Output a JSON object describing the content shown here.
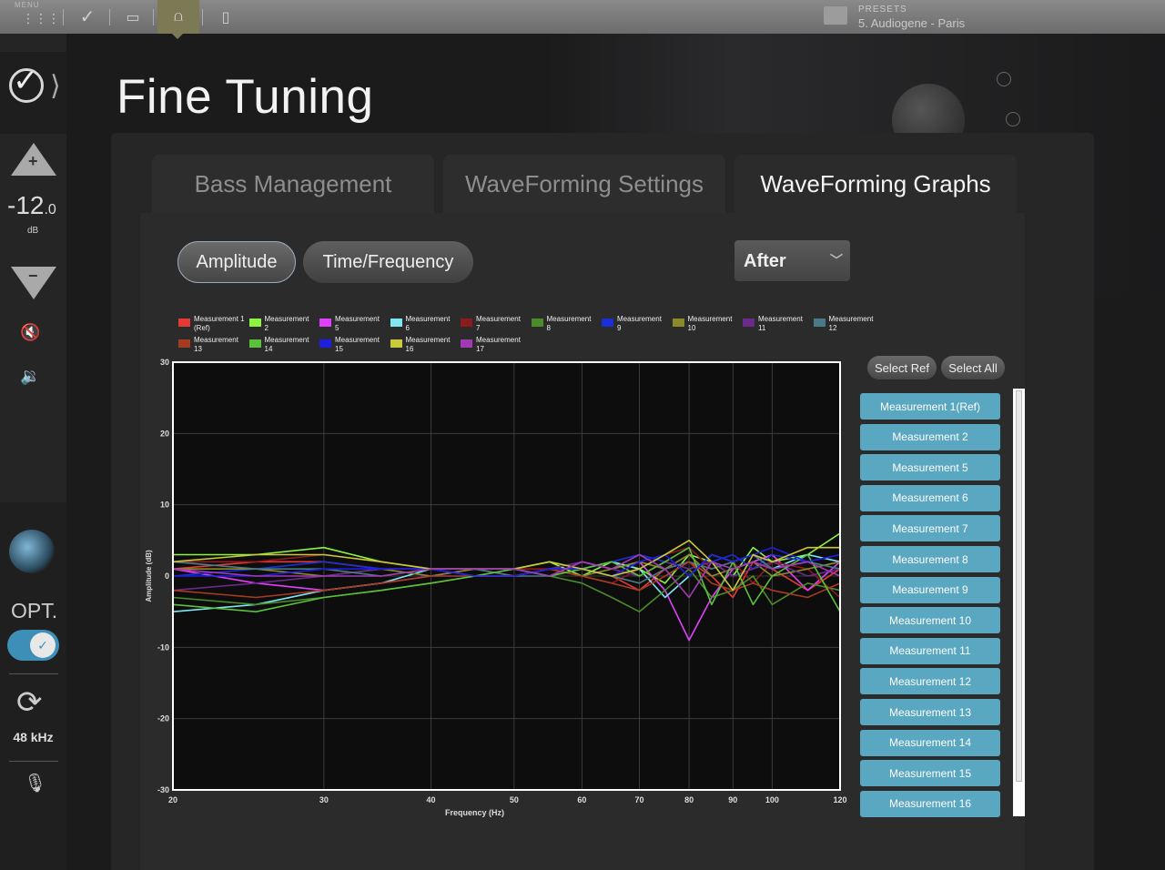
{
  "topbar": {
    "menu_label": "MENU",
    "presets_label": "PRESETS",
    "preset_value": "5. Audiogene - Paris"
  },
  "sidebar": {
    "volume_value": "-12",
    "volume_decimal": ".0",
    "volume_unit": "dB",
    "input_label": "OPT.",
    "sample_rate": "48 kHz"
  },
  "page": {
    "title": "Fine Tuning"
  },
  "tabs": [
    {
      "label": "Bass Management",
      "active": false
    },
    {
      "label": "WaveForming Settings",
      "active": false
    },
    {
      "label": "WaveForming Graphs",
      "active": true
    }
  ],
  "view_toggle": {
    "amplitude": "Amplitude",
    "time_frequency": "Time/Frequency"
  },
  "dropdown": {
    "value": "After"
  },
  "buttons": {
    "select_ref": "Select Ref",
    "select_all": "Select All"
  },
  "measurements": [
    "Measurement 1(Ref)",
    "Measurement 2",
    "Measurement 5",
    "Measurement 6",
    "Measurement 7",
    "Measurement 8",
    "Measurement 9",
    "Measurement 10",
    "Measurement 11",
    "Measurement 12",
    "Measurement 13",
    "Measurement 14",
    "Measurement 15",
    "Measurement 16"
  ],
  "chart_data": {
    "type": "line",
    "xlabel": "Frequency (Hz)",
    "ylabel": "Amplitude (dB)",
    "xscale": "log",
    "xlim": [
      20,
      120
    ],
    "ylim": [
      -30,
      30
    ],
    "xticks": [
      20,
      30,
      40,
      50,
      60,
      70,
      80,
      90,
      100,
      120
    ],
    "yticks": [
      30,
      20,
      10,
      0,
      -10,
      -20,
      -30
    ],
    "grid": true,
    "legend_placement": "top",
    "x": [
      20,
      25,
      30,
      35,
      40,
      45,
      50,
      55,
      60,
      65,
      70,
      75,
      80,
      85,
      90,
      95,
      100,
      110,
      120
    ],
    "series": [
      {
        "name": "Measurement 1 (Ref)",
        "color": "#e53935",
        "legend": [
          "Measurement 1",
          "(Ref)"
        ],
        "values": [
          1,
          2,
          2,
          1,
          1,
          1,
          0,
          1,
          1,
          0,
          -2,
          1,
          2,
          0,
          -3,
          2,
          1,
          -2,
          1
        ]
      },
      {
        "name": "Measurement 2",
        "color": "#8cf542",
        "legend": [
          "Measurement",
          "2"
        ],
        "values": [
          3,
          3,
          4,
          2,
          1,
          1,
          1,
          2,
          0,
          2,
          1,
          -1,
          3,
          2,
          0,
          4,
          2,
          3,
          6
        ]
      },
      {
        "name": "Measurement 5",
        "color": "#e040fb",
        "legend": [
          "Measurement",
          "5"
        ],
        "values": [
          1,
          -1,
          -2,
          -1,
          0,
          1,
          1,
          0,
          2,
          1,
          2,
          -2,
          -9,
          -3,
          1,
          2,
          3,
          -2,
          2
        ]
      },
      {
        "name": "Measurement 6",
        "color": "#7fe6f2",
        "legend": [
          "Measurement",
          "6"
        ],
        "values": [
          -5,
          -4,
          -2,
          -1,
          1,
          0,
          0,
          1,
          1,
          2,
          1,
          -3,
          0,
          3,
          2,
          3,
          1,
          3,
          2
        ]
      },
      {
        "name": "Measurement 7",
        "color": "#8b1a1a",
        "legend": [
          "Measurement",
          "7"
        ],
        "values": [
          2,
          2,
          3,
          2,
          1,
          0,
          1,
          1,
          0,
          -1,
          1,
          3,
          4,
          1,
          2,
          -1,
          2,
          1,
          -3
        ]
      },
      {
        "name": "Measurement 8",
        "color": "#4a8c2a",
        "legend": [
          "Measurement",
          "8"
        ],
        "values": [
          -3,
          -4,
          -3,
          -2,
          -1,
          0,
          1,
          0,
          -1,
          -3,
          -5,
          -2,
          1,
          -3,
          -2,
          0,
          -4,
          -1,
          -2
        ]
      },
      {
        "name": "Measurement 9",
        "color": "#1a2fd8",
        "legend": [
          "Measurement",
          "9"
        ],
        "values": [
          0,
          1,
          2,
          1,
          0,
          0,
          1,
          0,
          1,
          2,
          3,
          2,
          1,
          2,
          3,
          1,
          3,
          2,
          3
        ]
      },
      {
        "name": "Measurement 10",
        "color": "#8a8a2a",
        "legend": [
          "Measurement",
          "10"
        ],
        "values": [
          1,
          1,
          0,
          1,
          0,
          1,
          0,
          1,
          0,
          1,
          2,
          1,
          3,
          0,
          1,
          2,
          0,
          1,
          2
        ]
      },
      {
        "name": "Measurement 11",
        "color": "#6a2a8a",
        "legend": [
          "Measurement",
          "11"
        ],
        "values": [
          -2,
          -1,
          0,
          1,
          1,
          0,
          0,
          1,
          2,
          1,
          0,
          2,
          1,
          2,
          0,
          1,
          2,
          0,
          1
        ]
      },
      {
        "name": "Measurement 12",
        "color": "#4a7a88",
        "legend": [
          "Measurement",
          "12"
        ],
        "values": [
          2,
          1,
          1,
          0,
          1,
          1,
          0,
          0,
          1,
          0,
          -1,
          1,
          2,
          1,
          2,
          3,
          1,
          2,
          1
        ]
      },
      {
        "name": "Measurement 13",
        "color": "#a83a22",
        "legend": [
          "Measurement 13"
        ],
        "values": [
          -2,
          -3,
          -2,
          -1,
          0,
          0,
          0,
          1,
          0,
          -1,
          -2,
          0,
          2,
          -1,
          -2,
          -1,
          -2,
          -3,
          -1
        ]
      },
      {
        "name": "Measurement 14",
        "color": "#5ac23a",
        "legend": [
          "Measurement",
          "14"
        ],
        "values": [
          -4,
          -5,
          -3,
          -2,
          -1,
          0,
          1,
          0,
          1,
          2,
          0,
          2,
          4,
          -4,
          2,
          -4,
          0,
          3,
          -5
        ]
      },
      {
        "name": "Measurement 15",
        "color": "#1e1ee0",
        "legend": [
          "Measurement",
          "15"
        ],
        "values": [
          0,
          0,
          1,
          1,
          1,
          0,
          0,
          1,
          1,
          0,
          2,
          3,
          0,
          3,
          2,
          3,
          4,
          2,
          3
        ]
      },
      {
        "name": "Measurement 16",
        "color": "#c9c93a",
        "legend": [
          "Measurement",
          "16"
        ],
        "values": [
          2,
          3,
          3,
          2,
          1,
          1,
          1,
          2,
          1,
          0,
          1,
          3,
          5,
          2,
          -2,
          3,
          2,
          4,
          4
        ]
      },
      {
        "name": "Measurement 17",
        "color": "#a23ab5",
        "legend": [
          "Measurement",
          "17"
        ],
        "values": [
          1,
          0,
          0,
          0,
          1,
          1,
          1,
          0,
          2,
          1,
          3,
          1,
          -3,
          2,
          1,
          2,
          1,
          2,
          0
        ]
      }
    ]
  }
}
